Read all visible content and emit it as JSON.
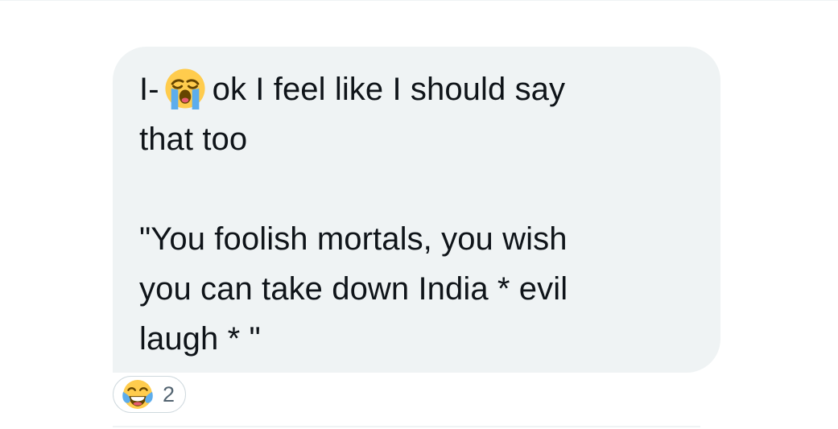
{
  "message": {
    "line1_prefix": "I-",
    "line1_emoji": "loudly-crying-face-icon",
    "line1_suffix": "ok I feel like I should say",
    "line2": "that too",
    "line4": "\"You foolish mortals, you wish",
    "line5": "you can take down India * evil",
    "line6": "laugh * \""
  },
  "reaction": {
    "emoji": "face-with-tears-of-joy-icon",
    "count": "2"
  },
  "colors": {
    "bubble_bg": "#eff3f4",
    "text": "#0f1419",
    "pill_border": "#cfd9de"
  }
}
